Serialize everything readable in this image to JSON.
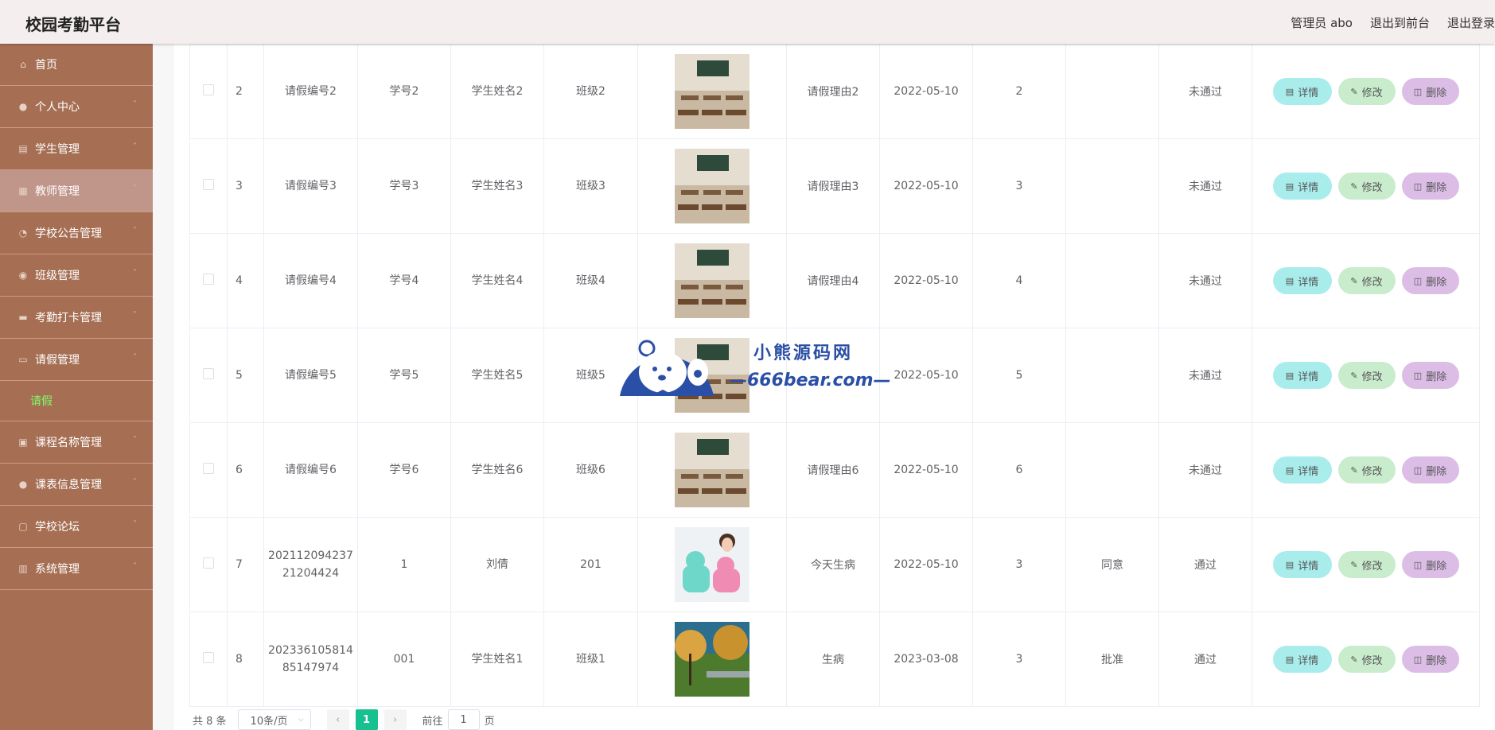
{
  "header": {
    "app_title": "校园考勤平台",
    "admin_label": "管理员 abo",
    "back_to_front": "退出到前台",
    "logout": "退出登录"
  },
  "sidebar": {
    "items": [
      {
        "label": "首页",
        "icon": "home-icon",
        "has_chevron": false
      },
      {
        "label": "个人中心",
        "icon": "user-icon",
        "has_chevron": true
      },
      {
        "label": "学生管理",
        "icon": "clipboard-icon",
        "has_chevron": true
      },
      {
        "label": "教师管理",
        "icon": "grid-icon",
        "has_chevron": true,
        "active": true
      },
      {
        "label": "学校公告管理",
        "icon": "gauge-icon",
        "has_chevron": true
      },
      {
        "label": "班级管理",
        "icon": "location-icon",
        "has_chevron": true
      },
      {
        "label": "考勤打卡管理",
        "icon": "ticket-icon",
        "has_chevron": true
      },
      {
        "label": "请假管理",
        "icon": "chat-icon",
        "has_chevron": true,
        "expanded": true
      },
      {
        "label": "课程名称管理",
        "icon": "checkbox-icon",
        "has_chevron": true
      },
      {
        "label": "课表信息管理",
        "icon": "user-icon",
        "has_chevron": true
      },
      {
        "label": "学校论坛",
        "icon": "crop-icon",
        "has_chevron": true
      },
      {
        "label": "系统管理",
        "icon": "printer-icon",
        "has_chevron": true
      }
    ],
    "submenu": {
      "label": "请假"
    }
  },
  "table": {
    "rows": [
      {
        "index": "2",
        "leave_no": "请假编号2",
        "student_id": "学号2",
        "student_name": "学生姓名2",
        "class": "班级2",
        "image": "classroom-photo",
        "reason": "请假理由2",
        "date": "2022-05-10",
        "days": "2",
        "reply": "",
        "status": "未通过"
      },
      {
        "index": "3",
        "leave_no": "请假编号3",
        "student_id": "学号3",
        "student_name": "学生姓名3",
        "class": "班级3",
        "image": "classroom-photo",
        "reason": "请假理由3",
        "date": "2022-05-10",
        "days": "3",
        "reply": "",
        "status": "未通过"
      },
      {
        "index": "4",
        "leave_no": "请假编号4",
        "student_id": "学号4",
        "student_name": "学生姓名4",
        "class": "班级4",
        "image": "classroom-photo",
        "reason": "请假理由4",
        "date": "2022-05-10",
        "days": "4",
        "reply": "",
        "status": "未通过"
      },
      {
        "index": "5",
        "leave_no": "请假编号5",
        "student_id": "学号5",
        "student_name": "学生姓名5",
        "class": "班级5",
        "image": "classroom-photo",
        "reason": "",
        "date": "2022-05-10",
        "days": "5",
        "reply": "",
        "status": "未通过"
      },
      {
        "index": "6",
        "leave_no": "请假编号6",
        "student_id": "学号6",
        "student_name": "学生姓名6",
        "class": "班级6",
        "image": "classroom-photo",
        "reason": "请假理由6",
        "date": "2022-05-10",
        "days": "6",
        "reply": "",
        "status": "未通过"
      },
      {
        "index": "7",
        "leave_no": "202112094237\n21204424",
        "student_id": "1",
        "student_name": "刘倩",
        "class": "201",
        "image": "person-photo",
        "reason": "今天生病",
        "date": "2022-05-10",
        "days": "3",
        "reply": "同意",
        "status": "通过"
      },
      {
        "index": "8",
        "leave_no": "202336105814\n85147974",
        "student_id": "001",
        "student_name": "学生姓名1",
        "class": "班级1",
        "image": "park-photo",
        "reason": "生病",
        "date": "2023-03-08",
        "days": "3",
        "reply": "批准",
        "status": "通过"
      }
    ],
    "actions": {
      "detail": "详情",
      "edit": "修改",
      "delete": "删除"
    }
  },
  "pagination": {
    "total_text": "共 8 条",
    "page_size": "10条/页",
    "current_page": "1",
    "goto_label": "前往",
    "goto_value": "1",
    "page_unit": "页"
  },
  "watermark": {
    "cn_text": "小熊源码网",
    "en_text": "—666bear.com—"
  },
  "colors": {
    "sidebar_bg": "#a66f54",
    "submenu_active": "#7cfc6a",
    "pager_active": "#16c08f",
    "btn_detail": "#a9ecec",
    "btn_edit": "#c9eccd",
    "btn_delete": "#dbbde6"
  }
}
